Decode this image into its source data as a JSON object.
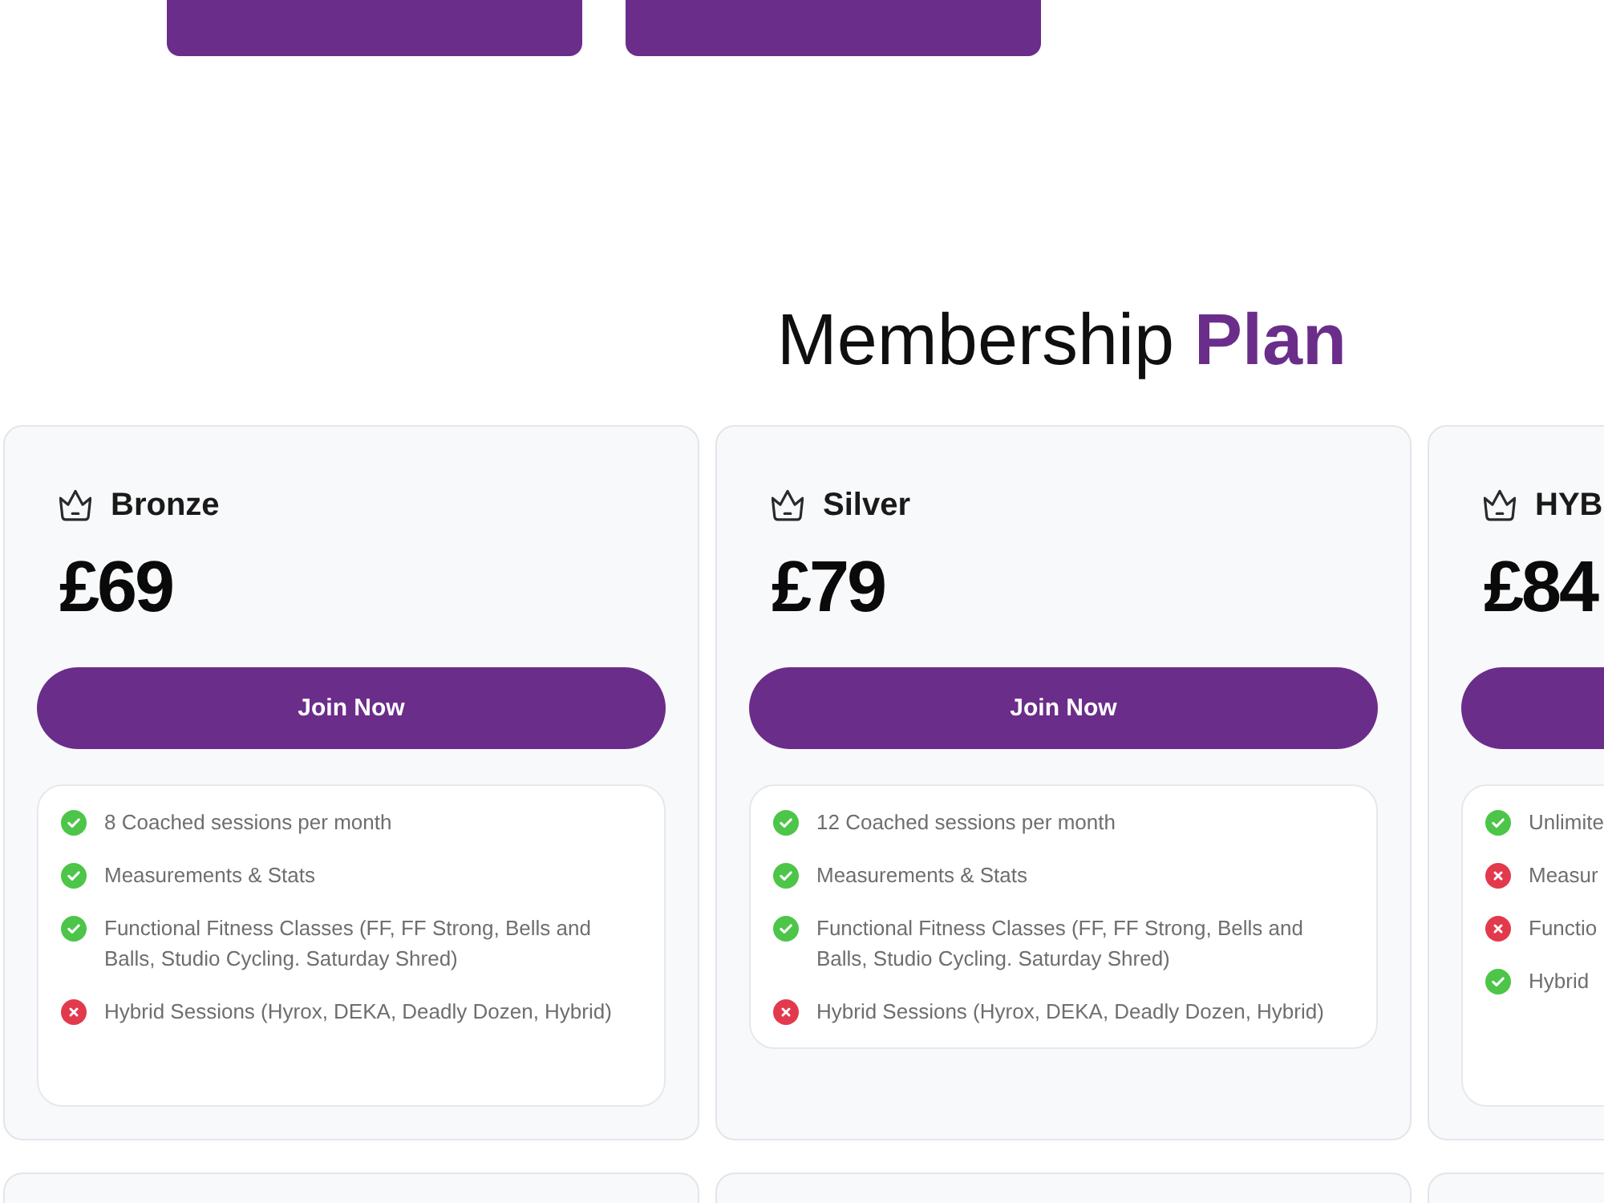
{
  "top_actions": [
    {
      "kind": "filled"
    },
    {
      "kind": "filled"
    }
  ],
  "section": {
    "title": "Membership **Plan**"
  },
  "plans": [
    {
      "name": "Bronze",
      "price": "£69",
      "action": "Join Now",
      "features": [
        {
          "text": "8 Coached sessions per month",
          "included": true
        },
        {
          "text": "Measurements & Stats",
          "included": true
        },
        {
          "text": "Functional Fitness Classes (FF, FF Strong, Bells and Balls, Studio Cycling. Saturday Shred)",
          "included": true
        },
        {
          "text": "Hybrid Sessions (Hyrox, DEKA, Deadly Dozen, Hybrid)",
          "included": false
        }
      ]
    },
    {
      "name": "Silver",
      "price": "£79",
      "action": "Join Now",
      "features": [
        {
          "text": "12 Coached sessions per month",
          "included": true
        },
        {
          "text": "Measurements & Stats",
          "included": true
        },
        {
          "text": "Functional Fitness Classes (FF, FF Strong, Bells and Balls, Studio Cycling. Saturday Shred)",
          "included": true
        },
        {
          "text": "Hybrid Sessions (Hyrox, DEKA, Deadly Dozen, Hybrid)",
          "included": false
        }
      ]
    },
    {
      "name": "HYB",
      "price": "£84",
      "features": [
        {
          "text": "Unlimite",
          "included": true
        },
        {
          "text": "Measur",
          "included": false
        },
        {
          "text": "Functio",
          "included": false
        },
        {
          "text": "Hybrid",
          "included": true
        }
      ]
    }
  ],
  "next_row": [
    {
      "kind": "plan-card"
    },
    {
      "kind": "plan-card"
    },
    {
      "kind": "plan-card"
    }
  ]
}
